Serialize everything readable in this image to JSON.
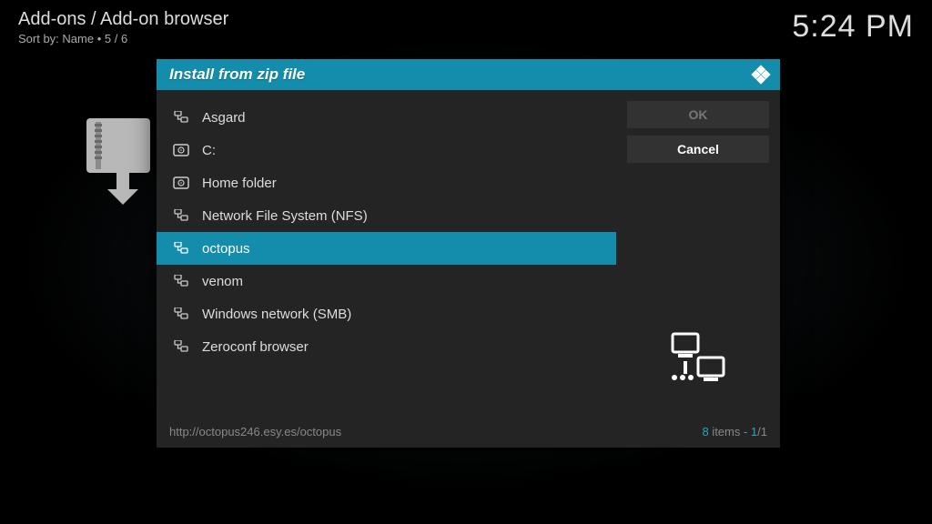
{
  "header": {
    "breadcrumb": "Add-ons / Add-on browser",
    "sort_label": "Sort by: Name ",
    "sort_sep": " • ",
    "sort_pos": " 5 / 6",
    "clock": "5:24 PM"
  },
  "dialog": {
    "title": "Install from zip file",
    "buttons": {
      "ok": "OK",
      "cancel": "Cancel"
    },
    "items": [
      {
        "label": "Asgard",
        "icon": "net",
        "selected": false
      },
      {
        "label": "C:",
        "icon": "disk",
        "selected": false
      },
      {
        "label": "Home folder",
        "icon": "disk",
        "selected": false
      },
      {
        "label": "Network File System (NFS)",
        "icon": "net",
        "selected": false
      },
      {
        "label": "octopus",
        "icon": "net",
        "selected": true
      },
      {
        "label": "venom",
        "icon": "net",
        "selected": false
      },
      {
        "label": "Windows network (SMB)",
        "icon": "net",
        "selected": false
      },
      {
        "label": "Zeroconf browser",
        "icon": "net",
        "selected": false
      }
    ],
    "footer": {
      "path": "http://octopus246.esy.es/octopus",
      "items_count": "8",
      "items_label": " items - ",
      "page_cur": "1",
      "page_total": "/1"
    }
  }
}
